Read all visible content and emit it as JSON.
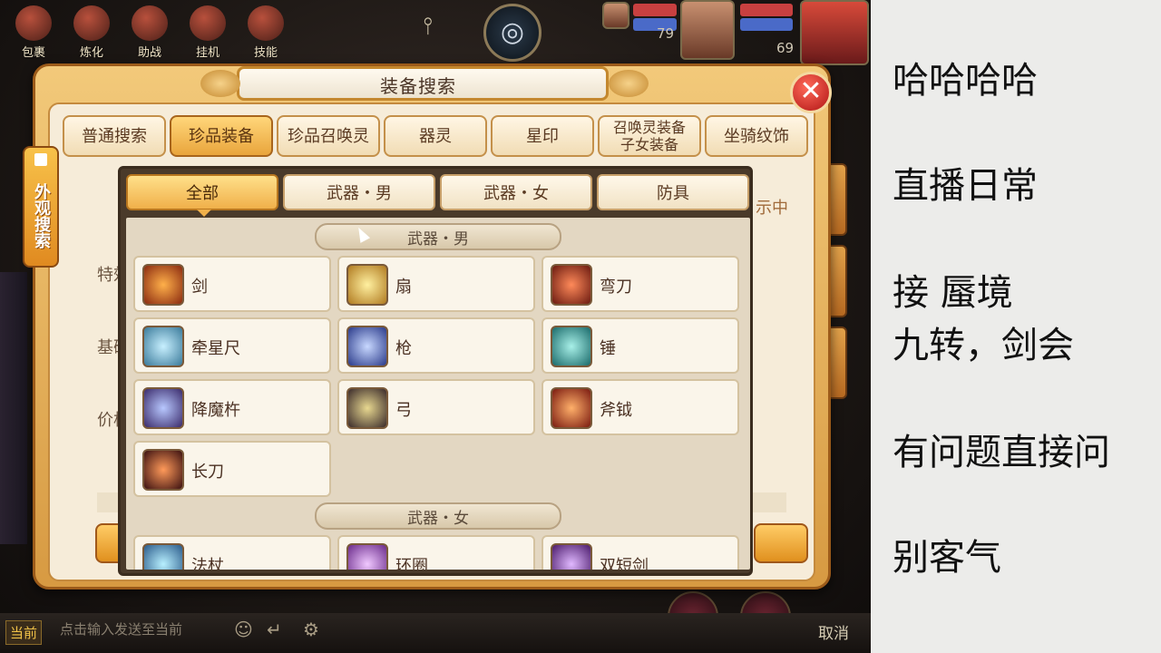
{
  "game": {
    "top_menu": [
      {
        "label": "包裹",
        "icon": "bag-icon"
      },
      {
        "label": "炼化",
        "icon": "forge-icon"
      },
      {
        "label": "助战",
        "icon": "assist-icon"
      },
      {
        "label": "挂机",
        "icon": "idle-icon"
      },
      {
        "label": "技能",
        "icon": "skill-icon"
      }
    ],
    "hud": {
      "level_a": "79",
      "level_b": "69"
    },
    "chat": {
      "channel": "当前",
      "placeholder": "点击输入发送至当前"
    },
    "cancel_label": "取消"
  },
  "dialog": {
    "title": "装备搜索",
    "side_tab": "外观搜索",
    "main_tabs": [
      "普通搜索",
      "珍品装备",
      "珍品召唤灵",
      "器灵",
      "星印",
      "召唤灵装备\n子女装备",
      "坐骑纹饰"
    ],
    "active_main_tab": "珍品装备",
    "bg_labels": [
      "特效",
      "基础",
      "价格"
    ],
    "bg_right": "示中",
    "dropdown": {
      "sub_tabs": [
        "全部",
        "武器・男",
        "武器・女",
        "防具"
      ],
      "active_sub_tab": "全部",
      "sections": [
        {
          "title": "武器・男",
          "items": [
            "剑",
            "扇",
            "弯刀",
            "牵星尺",
            "枪",
            "锤",
            "降魔杵",
            "弓",
            "斧钺",
            "长刀"
          ]
        },
        {
          "title": "武器・女",
          "items": [
            "法杖",
            "环圈",
            "双短剑"
          ]
        }
      ]
    }
  },
  "notes": [
    "哈哈哈哈",
    "直播日常",
    "接 蜃境",
    "九转，剑会",
    "有问题直接问",
    "别客气"
  ],
  "colors": {
    "accent": "#e9a53c",
    "panel": "#f6ecd9",
    "close": "#b01414"
  }
}
